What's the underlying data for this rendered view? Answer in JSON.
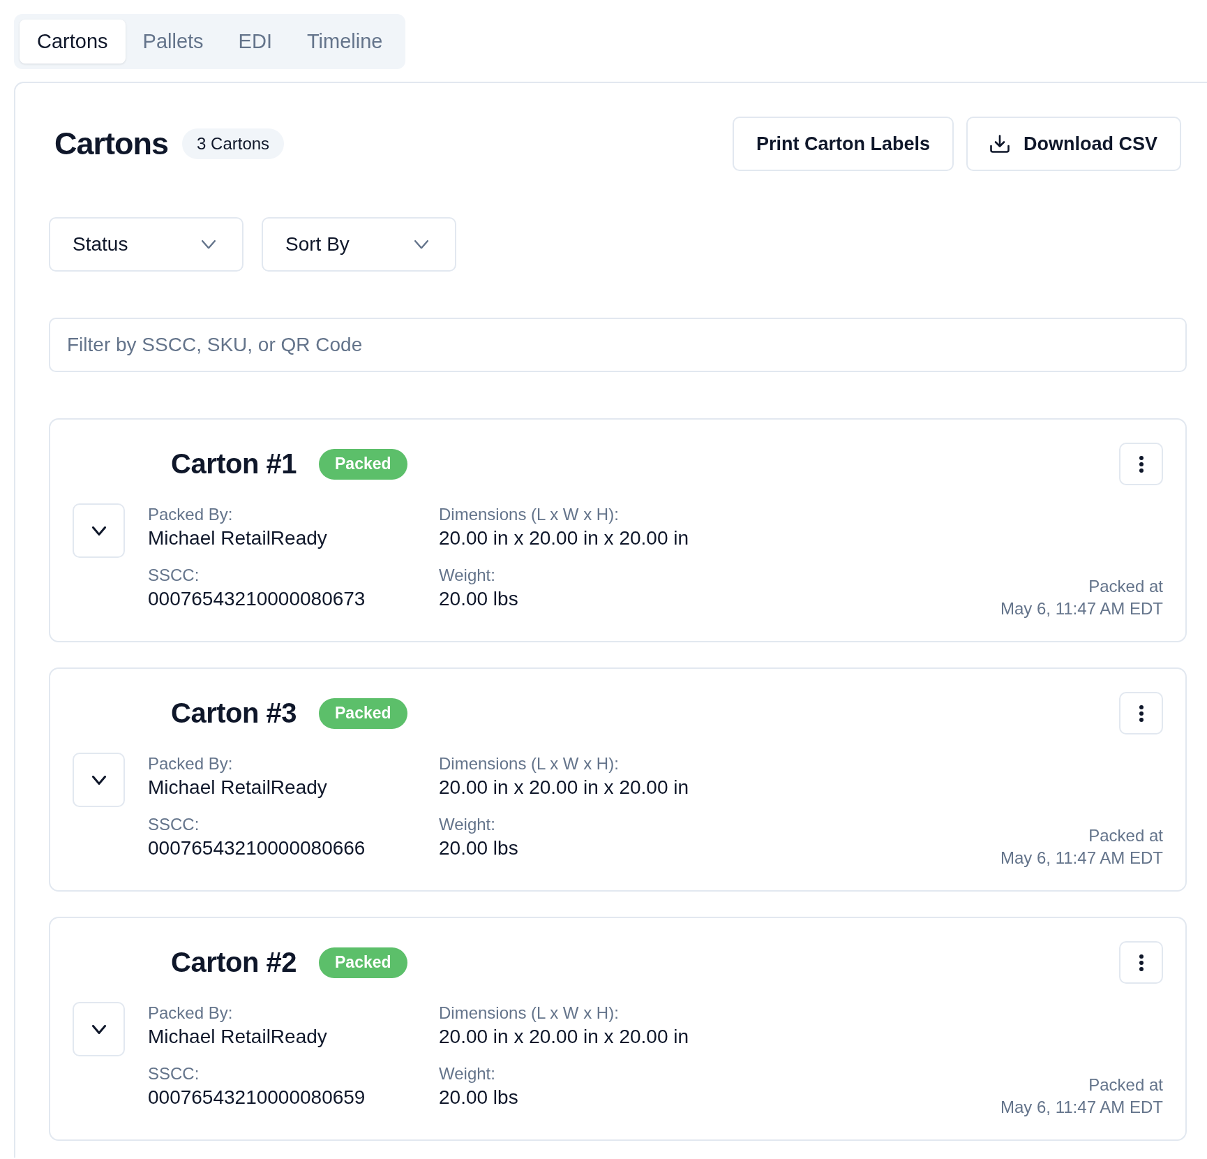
{
  "tabs": [
    {
      "label": "Cartons",
      "selected": true
    },
    {
      "label": "Pallets",
      "selected": false
    },
    {
      "label": "EDI",
      "selected": false
    },
    {
      "label": "Timeline",
      "selected": false
    }
  ],
  "header": {
    "title": "Cartons",
    "count_badge": "3 Cartons",
    "buttons": [
      {
        "kind": "print",
        "label": "Print Carton Labels"
      },
      {
        "kind": "download",
        "label": "Download CSV"
      }
    ]
  },
  "filters": [
    {
      "label": "Status"
    },
    {
      "label": "Sort By"
    }
  ],
  "search": {
    "placeholder": "Filter by SSCC, SKU, or QR Code"
  },
  "cartons": [
    {
      "title": "Carton #1",
      "status": "Packed",
      "expanded": false,
      "fields": [
        {
          "label": "Packed By:",
          "value": "Michael RetailReady"
        },
        {
          "label": "Dimensions (L x W x H):",
          "value": "20.00 in x 20.00 in x 20.00 in"
        },
        {
          "label": "SSCC:",
          "value": "00076543210000080673"
        },
        {
          "label": "Weight:",
          "value": "20.00 lbs"
        }
      ],
      "packed_at_label": "Packed at",
      "packed_at": "May 6, 11:47 AM EDT"
    },
    {
      "title": "Carton #3",
      "status": "Packed",
      "expanded": false,
      "fields": [
        {
          "label": "Packed By:",
          "value": "Michael RetailReady"
        },
        {
          "label": "Dimensions (L x W x H):",
          "value": "20.00 in x 20.00 in x 20.00 in"
        },
        {
          "label": "SSCC:",
          "value": "00076543210000080666"
        },
        {
          "label": "Weight:",
          "value": "20.00 lbs"
        }
      ],
      "packed_at_label": "Packed at",
      "packed_at": "May 6, 11:47 AM EDT"
    },
    {
      "title": "Carton #2",
      "status": "Packed",
      "expanded": false,
      "fields": [
        {
          "label": "Packed By:",
          "value": "Michael RetailReady"
        },
        {
          "label": "Dimensions (L x W x H):",
          "value": "20.00 in x 20.00 in x 20.00 in"
        },
        {
          "label": "SSCC:",
          "value": "00076543210000080659"
        },
        {
          "label": "Weight:",
          "value": "20.00 lbs"
        }
      ],
      "packed_at_label": "Packed at",
      "packed_at": "May 6, 11:47 AM EDT"
    }
  ]
}
